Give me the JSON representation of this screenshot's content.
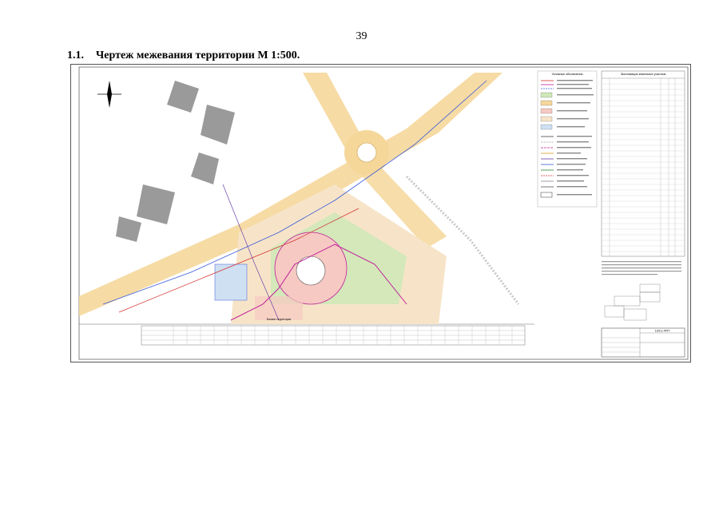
{
  "page": {
    "number": "39",
    "section_number": "1.1.",
    "section_title": "Чертеж межевания территории М 1:500."
  },
  "colors": {
    "road": "#f5d79a",
    "zone_green": "#cfe8b8",
    "zone_pink": "#f6c9c2",
    "zone_blue": "#cfe0f2",
    "building": "#9a9a9a",
    "magenta_line": "#c0209a",
    "red_line": "#d43030",
    "blue_line": "#3a5bd9"
  },
  "legend": {
    "title": "Условные обозначения"
  },
  "parcels_table": {
    "title": "Экспликация земельных участков"
  },
  "bottom_table": {
    "title": "Баланс территории"
  },
  "title_block": {
    "code": "19/3.1-ППТ"
  }
}
